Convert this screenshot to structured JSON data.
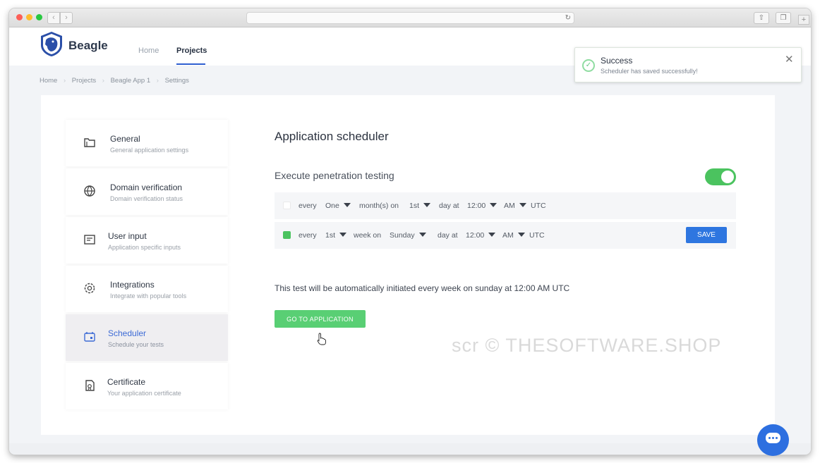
{
  "app": {
    "brand": "Beagle"
  },
  "topnav": {
    "home": "Home",
    "projects": "Projects"
  },
  "toast": {
    "title": "Success",
    "message": "Scheduler has saved successfully!",
    "close": "✕"
  },
  "breadcrumb": [
    "Home",
    "Projects",
    "Beagle App 1",
    "Settings"
  ],
  "sidebar": {
    "items": [
      {
        "title": "General",
        "subtitle": "General application settings",
        "icon": "folder-icon"
      },
      {
        "title": "Domain verification",
        "subtitle": "Domain verification status",
        "icon": "globe-icon"
      },
      {
        "title": "User input",
        "subtitle": "Application specific inputs",
        "icon": "form-icon"
      },
      {
        "title": "Integrations",
        "subtitle": "Integrate with popular tools",
        "icon": "gear-icon"
      },
      {
        "title": "Scheduler",
        "subtitle": "Schedule your tests",
        "icon": "calendar-icon"
      },
      {
        "title": "Certificate",
        "subtitle": "Your application certificate",
        "icon": "certificate-icon"
      }
    ],
    "active": "Scheduler"
  },
  "scheduler": {
    "title": "Application scheduler",
    "execute_label": "Execute penetration testing",
    "enabled": true,
    "row1": {
      "every": "every",
      "count": "One",
      "unit": "month(s) on",
      "day": "1st",
      "day_at": "day at",
      "time": "12:00",
      "ampm": "AM",
      "tz": "UTC",
      "checked": false
    },
    "row2": {
      "every": "every",
      "count": "1st",
      "unit": "week on",
      "day": "Sunday",
      "day_at": "day at",
      "time": "12:00",
      "ampm": "AM",
      "tz": "UTC",
      "checked": true
    },
    "save_label": "SAVE",
    "summary": "This test will be automatically initiated every week on sunday at 12:00 AM UTC",
    "go_label": "GO TO APPLICATION"
  },
  "watermark": "scr © THESOFTWARE.SHOP",
  "colors": {
    "accent": "#2e76e0",
    "success": "#4bc35f",
    "active_nav": "#3d6bd6"
  }
}
